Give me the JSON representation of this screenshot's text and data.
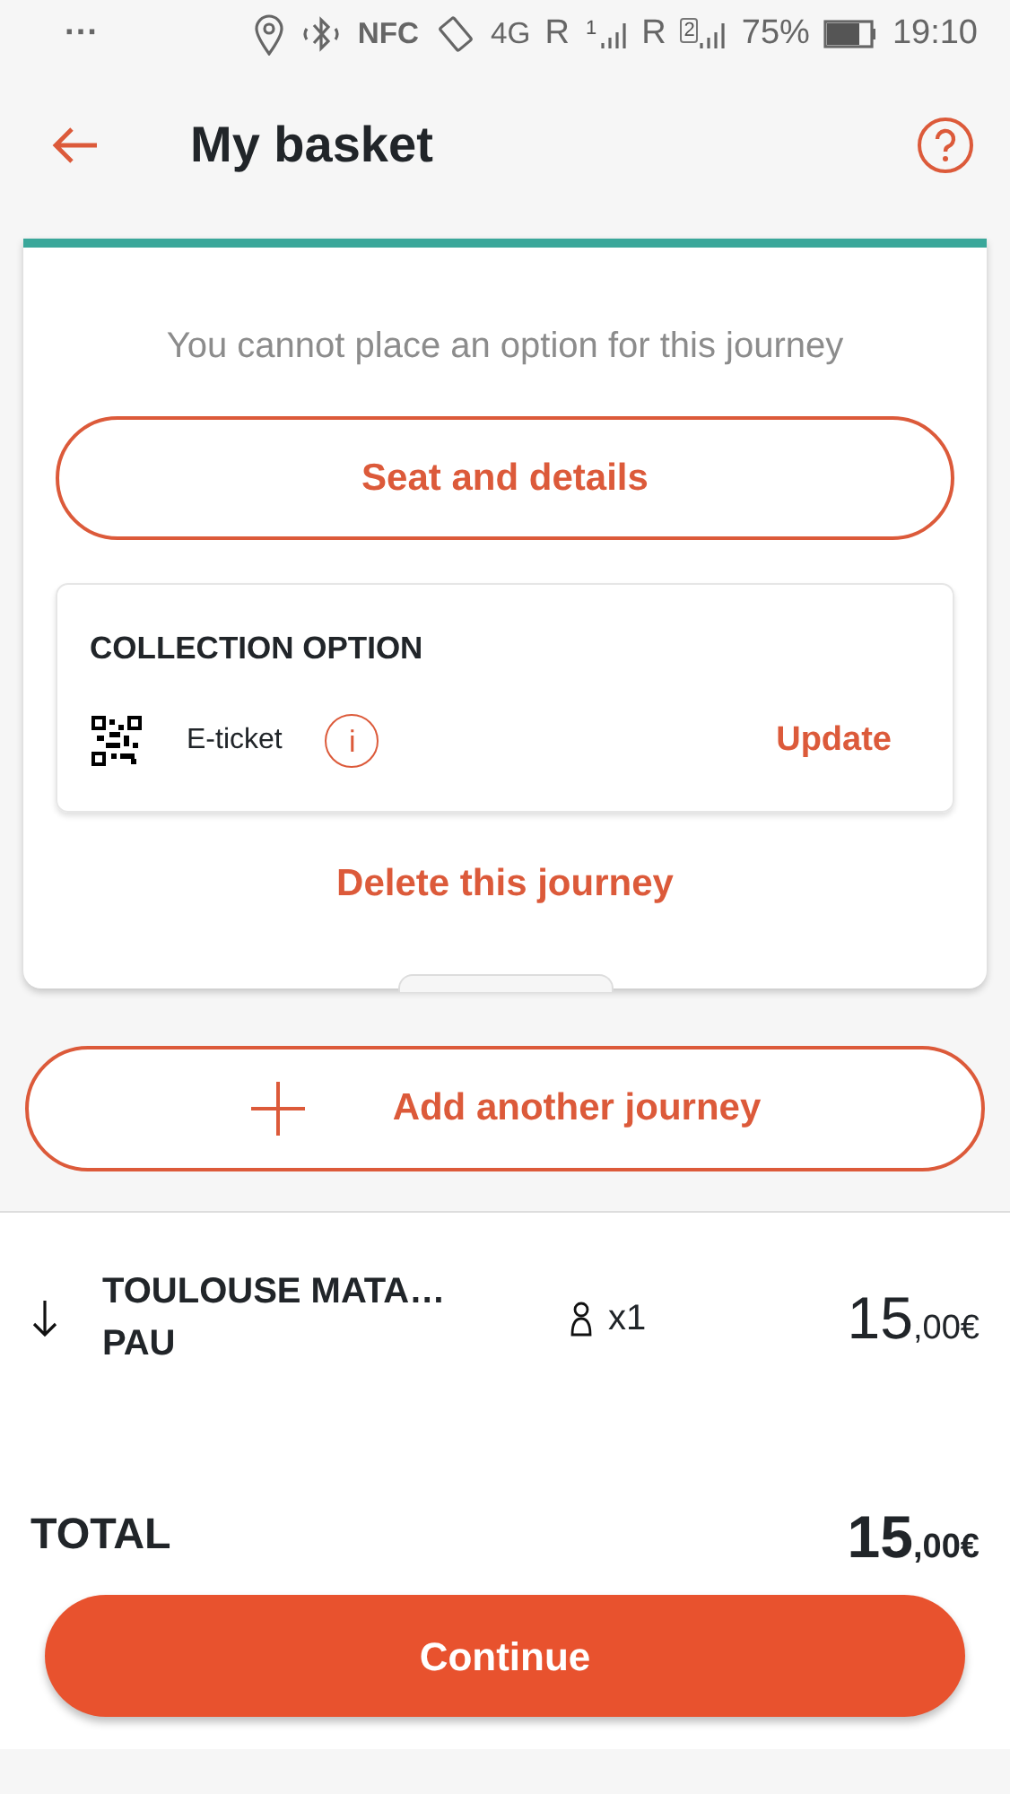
{
  "status_bar": {
    "menu_dots": "···",
    "nfc": "NFC",
    "network": "4G",
    "roaming_1": "R",
    "sim_1": "1",
    "roaming_2": "R",
    "sim_2": "2",
    "battery": "75%",
    "time": "19:10"
  },
  "header": {
    "title": "My basket"
  },
  "journey_card": {
    "notice": "You cannot place an option for this journey",
    "seat_button": "Seat and details",
    "collection": {
      "heading": "COLLECTION OPTION",
      "option": "E-ticket",
      "info": "i",
      "update": "Update"
    },
    "delete": "Delete this journey"
  },
  "add_button": "Add another journey",
  "summary": {
    "origin": "TOULOUSE MATA…",
    "destination": "PAU",
    "passengers": "x1",
    "price_main": "15",
    "price_cents": ",00€"
  },
  "total": {
    "label": "TOTAL",
    "price_main": "15",
    "price_cents": ",00€"
  },
  "continue_button": "Continue"
}
